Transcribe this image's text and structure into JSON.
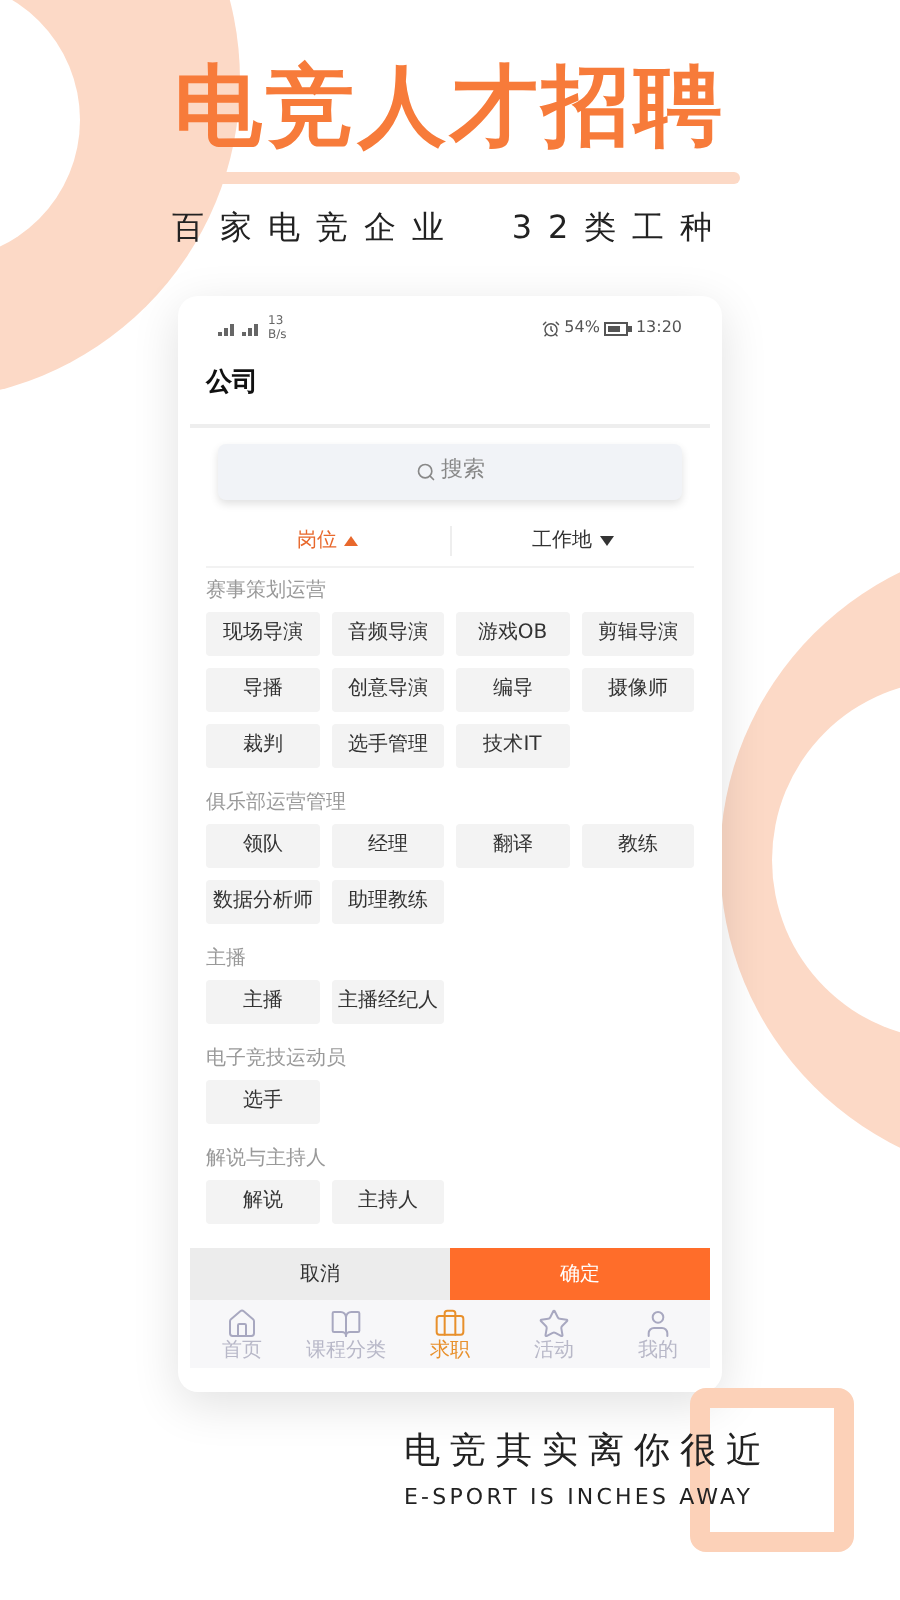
{
  "hero": {
    "title": "电竞人才招聘",
    "subtitle": [
      "百家电竞企业",
      "32类工种"
    ]
  },
  "phone": {
    "status_bar": {
      "speed": "13 B/s",
      "battery": "54%",
      "time": "13:20"
    },
    "header": {
      "title": "公司"
    },
    "search": {
      "placeholder": "搜索"
    },
    "filters": [
      {
        "label": "岗位",
        "selected": true
      },
      {
        "label": "工作地",
        "selected": false
      }
    ],
    "sections": [
      {
        "title": "赛事策划运营",
        "tags": [
          "现场导演",
          "音频导演",
          "游戏OB",
          "剪辑导演",
          "导播",
          "创意导演",
          "编导",
          "摄像师",
          "裁判",
          "选手管理",
          "技术IT"
        ]
      },
      {
        "title": "俱乐部运营管理",
        "tags": [
          "领队",
          "经理",
          "翻译",
          "教练",
          "数据分析师",
          "助理教练"
        ]
      },
      {
        "title": "主播",
        "tags": [
          "主播",
          "主播经纪人"
        ]
      },
      {
        "title": "电子竞技运动员",
        "tags": [
          "选手"
        ]
      },
      {
        "title": "解说与主持人",
        "tags": [
          "解说",
          "主持人"
        ]
      }
    ],
    "actions": {
      "cancel": "取消",
      "confirm": "确定"
    },
    "nav": [
      {
        "kind": "home",
        "label": "首页",
        "selected": false
      },
      {
        "kind": "book",
        "label": "课程分类",
        "selected": false
      },
      {
        "kind": "briefcase",
        "label": "求职",
        "selected": true
      },
      {
        "kind": "star",
        "label": "活动",
        "selected": false
      },
      {
        "kind": "user",
        "label": "我的",
        "selected": false
      }
    ]
  },
  "slogan": {
    "text": "电竞其实离你很近",
    "english": "E-SPORT IS INCHES AWAY"
  }
}
